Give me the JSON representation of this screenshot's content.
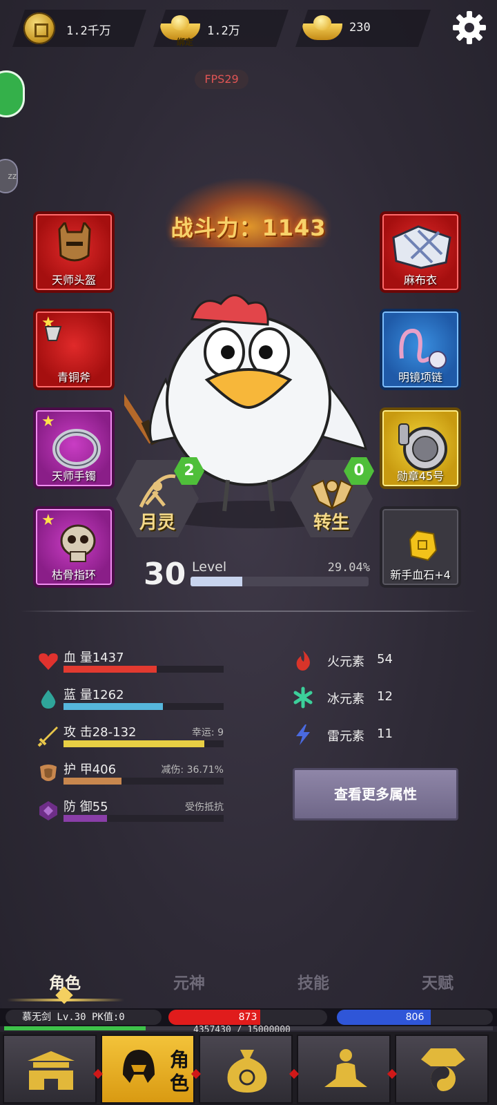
{
  "currency": {
    "copper": "1.2千万",
    "bound_gold": "1.2万",
    "bound_label": "绑定",
    "gold": "230"
  },
  "fps": "FPS29",
  "power": "战斗力：1143",
  "equipment": {
    "left": [
      {
        "label": "天师头盔",
        "color": "red",
        "star": false
      },
      {
        "label": "青铜斧",
        "color": "red",
        "star": true
      },
      {
        "label": "天师手镯",
        "color": "purple",
        "star": true
      },
      {
        "label": "枯骨指环",
        "color": "purple",
        "star": true
      }
    ],
    "right": [
      {
        "label": "麻布衣",
        "color": "red",
        "star": false
      },
      {
        "label": "明镜项链",
        "color": "blue",
        "star": false
      },
      {
        "label": "勋章45号",
        "color": "gold",
        "star": false
      },
      {
        "label": "新手血石+4",
        "color": "gray",
        "star": false
      }
    ]
  },
  "badges": {
    "moon": {
      "label": "月灵",
      "count": "2"
    },
    "rebirth": {
      "label": "转生",
      "count": "0"
    }
  },
  "level": {
    "number": "30",
    "label": "Level",
    "percent_text": "29.04%",
    "progress": 0.2904
  },
  "stats": [
    {
      "name": "血 量1437",
      "extra": "",
      "color": "#e23a30",
      "fill": 0.58
    },
    {
      "name": "蓝 量1262",
      "extra": "",
      "color": "#56b7dc",
      "fill": 0.62
    },
    {
      "name": "攻 击28-132",
      "extra": "幸运: 9",
      "color": "#e8cf44",
      "fill": 0.88
    },
    {
      "name": "护 甲406",
      "extra": "减伤: 36.71%",
      "color": "#c8874e",
      "fill": 0.36
    },
    {
      "name": "防 御55",
      "extra": "受伤抵抗",
      "color": "#8a3ea8",
      "fill": 0.27
    }
  ],
  "elements": [
    {
      "name": "火元素",
      "value": "54",
      "icon": "fire-icon",
      "color": "#d8342a"
    },
    {
      "name": "冰元素",
      "value": "12",
      "icon": "snowflake-icon",
      "color": "#3ccf9a"
    },
    {
      "name": "雷元素",
      "value": "11",
      "icon": "lightning-icon",
      "color": "#4a6ae0"
    }
  ],
  "more_button": "查看更多属性",
  "tabs": [
    "角色",
    "元神",
    "技能",
    "天赋"
  ],
  "player": {
    "info": "慕无剑  Lv.30 PK值:0",
    "hp": "873",
    "hp_fill": 0.58,
    "mp": "806",
    "mp_fill": 0.6,
    "exp_text": "4357430 / 15000000",
    "exp_fill": 0.29
  },
  "nav": {
    "active_label": "角色"
  }
}
